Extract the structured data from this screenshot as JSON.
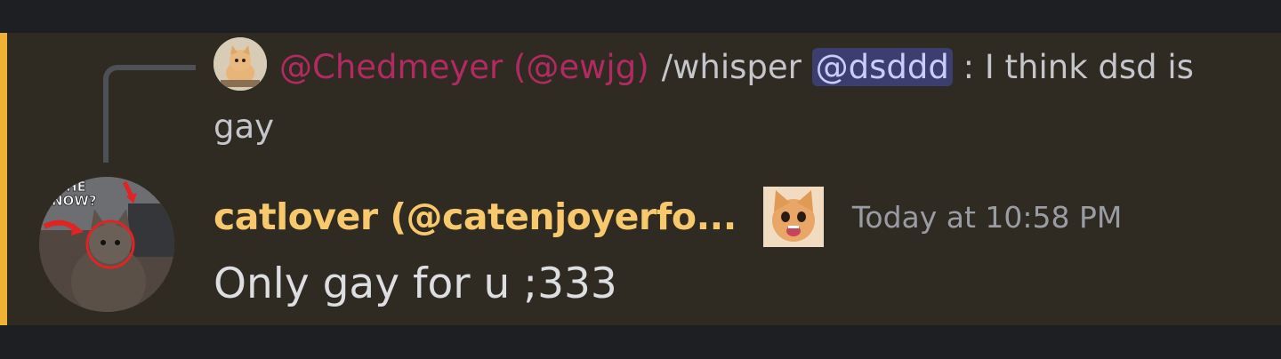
{
  "reply": {
    "author": "@Chedmeyer (@ewjg)",
    "text_before": "/whisper ",
    "mention": "@dsddd",
    "text_after": " : I think dsd is gay"
  },
  "message": {
    "username": "catlover (@catenjoyerfo...",
    "timestamp": "Today at 10:58 PM",
    "content": "Only gay for u ;333"
  },
  "avatar": {
    "caption": "S HE\nNOW?"
  },
  "colors": {
    "highlight": "#f0b232",
    "reply_author": "#b22a62",
    "username": "#f8c96c",
    "mention_bg": "#3c3e70"
  }
}
